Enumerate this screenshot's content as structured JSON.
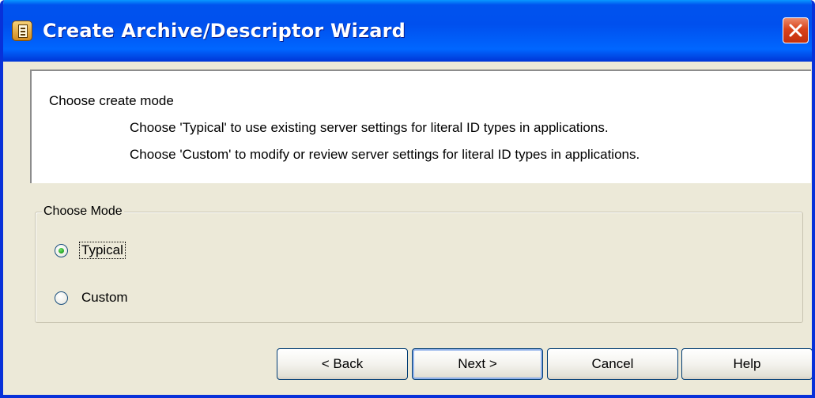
{
  "window": {
    "title": "Create Archive/Descriptor Wizard",
    "icon": "wizard-app-icon",
    "close_icon": "close-icon"
  },
  "header": {
    "title": "Choose create mode",
    "desc_typical": "Choose 'Typical' to use existing server settings for literal ID types in applications.",
    "desc_custom": "Choose 'Custom' to modify or review server settings for literal ID types in applications."
  },
  "mode_group": {
    "legend": "Choose Mode",
    "options": [
      {
        "label": "Typical",
        "selected": true
      },
      {
        "label": "Custom",
        "selected": false
      }
    ]
  },
  "buttons": {
    "back": "< Back",
    "next": "Next >",
    "cancel": "Cancel",
    "help": "Help"
  },
  "colors": {
    "titlebar": "#0053ee",
    "dialog_bg": "#ece9d8",
    "close_button": "#d9431a",
    "radio_selected": "#21a121"
  }
}
